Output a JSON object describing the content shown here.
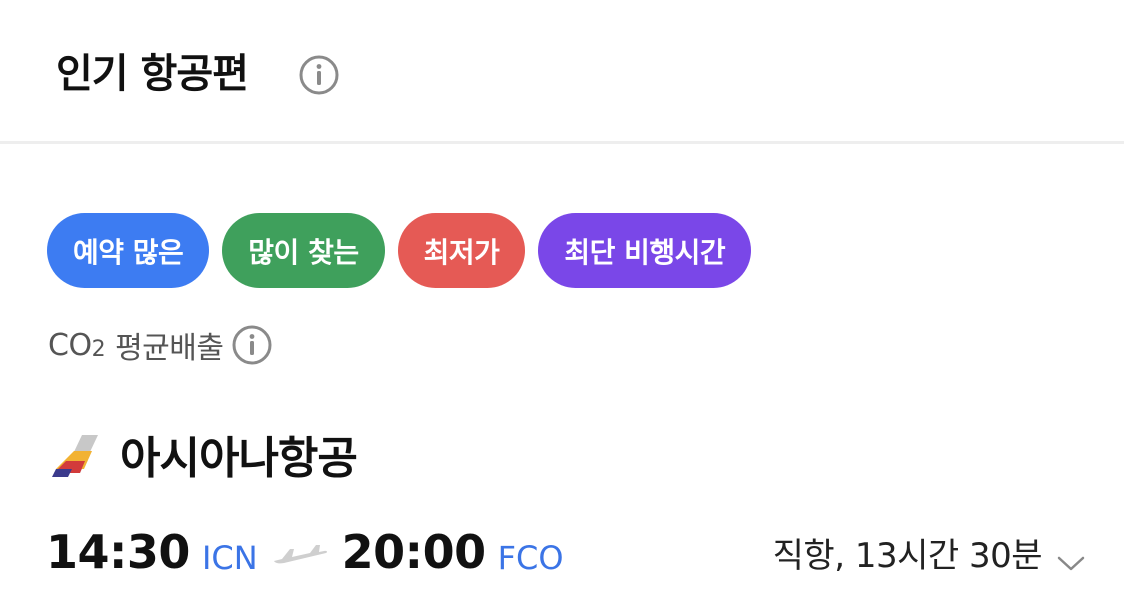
{
  "header": {
    "title": "인기 항공편",
    "info_icon": "info-circle-icon"
  },
  "tags": [
    {
      "label": "예약 많은",
      "color": "#3d7cf2"
    },
    {
      "label": "많이 찾는",
      "color": "#3fa05c"
    },
    {
      "label": "최저가",
      "color": "#e55a55"
    },
    {
      "label": "최단 비행시간",
      "color": "#7a47e8"
    }
  ],
  "co2": {
    "prefix": "CO",
    "subscript": "2",
    "label": "평균배출",
    "info_icon": "info-circle-icon"
  },
  "airline": {
    "name": "아시아나항공",
    "logo_icon": "asiana-logo-icon"
  },
  "flight": {
    "departure_time": "14:30",
    "departure_code": "ICN",
    "arrival_time": "20:00",
    "arrival_code": "FCO",
    "plane_icon": "plane-icon",
    "info": "직항, 13시간 30분",
    "expand_icon": "chevron-down-icon",
    "code_color": "#3b74e6"
  }
}
